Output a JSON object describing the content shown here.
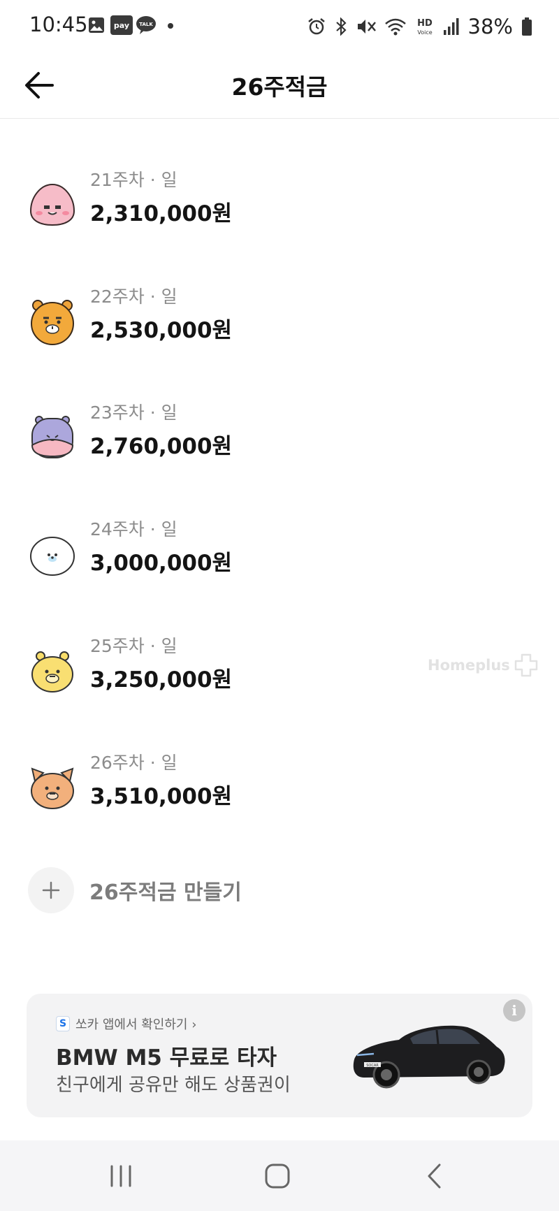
{
  "status_bar": {
    "time": "10:45",
    "battery": "38%",
    "left_icons": [
      "gallery-icon",
      "pay-icon",
      "talk-icon",
      "dot-icon"
    ],
    "right_icons": [
      "alarm-icon",
      "bluetooth-icon",
      "mute-icon",
      "wifi-icon",
      "hd-voice-icon",
      "signal-icon",
      "battery-icon"
    ],
    "pay_label": "pay",
    "talk_label": "TALK",
    "hd_label": "HD",
    "voice_label": "Voice"
  },
  "header": {
    "title": "26주적금",
    "back_icon": "arrow-left-icon"
  },
  "items": [
    {
      "meta": "21주차 · 일",
      "amount": "2,310,000원",
      "character": "peach"
    },
    {
      "meta": "22주차 · 일",
      "amount": "2,530,000원",
      "character": "lion"
    },
    {
      "meta": "23주차 · 일",
      "amount": "2,760,000원",
      "character": "hippo"
    },
    {
      "meta": "24주차 · 일",
      "amount": "3,000,000원",
      "character": "seal"
    },
    {
      "meta": "25주차 · 일",
      "amount": "3,250,000원",
      "character": "yellow-lion"
    },
    {
      "meta": "26주차 · 일",
      "amount": "3,510,000원",
      "character": "tiger"
    }
  ],
  "watermark": "Homeplus",
  "add_button": {
    "label": "26주적금 만들기",
    "icon": "plus-icon"
  },
  "ad": {
    "source": "쏘카 앱에서 확인하기 ›",
    "logo_letter": "S",
    "title": "BMW M5 무료로 타자",
    "subtitle": "친구에게 공유만 해도 상품권이",
    "info": "i",
    "plate": "SOCAR"
  },
  "colors": {
    "background": "#ffffff",
    "muted_text": "#8c8c8c",
    "ad_background": "#f3f3f4",
    "nav_background": "#f5f5f7"
  }
}
